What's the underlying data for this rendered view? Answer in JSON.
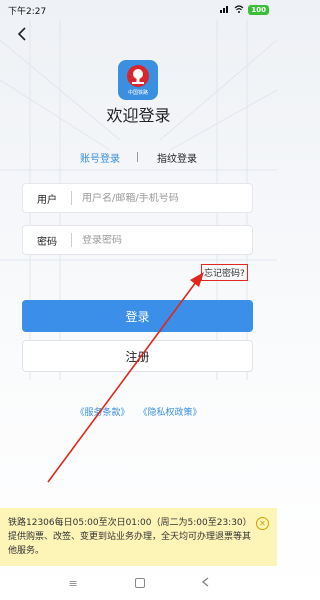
{
  "status_bar": {
    "time": "下午2:27",
    "battery": "100"
  },
  "header": {
    "logo_text": "中国铁路",
    "welcome": "欢迎登录"
  },
  "tabs": {
    "account_login": "账号登录",
    "fingerprint_login": "指纹登录"
  },
  "form": {
    "user_label": "用户",
    "user_placeholder": "用户名/邮箱/手机号码",
    "password_label": "密码",
    "password_placeholder": "登录密码",
    "forgot_password": "忘记密码?"
  },
  "buttons": {
    "login": "登录",
    "register": "注册"
  },
  "policy": {
    "terms": "《服务条款》",
    "privacy": "《隐私权政策》"
  },
  "notice": {
    "text": "铁路12306每日05:00至次日01:00（周二为5:00至23:30）提供购票、改签、变更到站业务办理，全天均可办理退票等其他服务。"
  },
  "icons": {
    "back": "back-arrow-icon",
    "logo": "china-railway-logo-icon",
    "close": "close-circle-icon",
    "nav_menu": "menu-icon",
    "nav_home": "home-icon",
    "nav_back": "back-icon"
  },
  "colors": {
    "accent": "#3b8fe8",
    "annotation": "#e0281e",
    "notice_bg": "#fdf4b8"
  }
}
